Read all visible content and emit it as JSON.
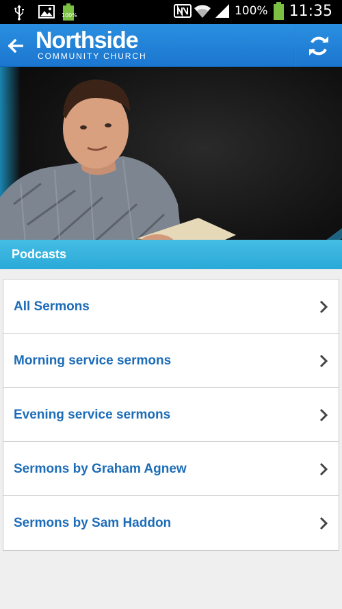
{
  "status_bar": {
    "battery_small_label": "100%",
    "battery_percent": "100%",
    "time": "11:35",
    "icons": [
      "usb-icon",
      "image-icon",
      "battery-icon",
      "nfc-icon",
      "wifi-icon",
      "signal-icon",
      "battery-icon"
    ]
  },
  "app_bar": {
    "logo_name": "Northside",
    "logo_sub": "COMMUNITY CHURCH",
    "back_icon": "arrow-left-icon",
    "refresh_icon": "refresh-icon"
  },
  "hero": {
    "caption": "Podcasts"
  },
  "list": {
    "items": [
      {
        "label": "All Sermons"
      },
      {
        "label": "Morning service sermons"
      },
      {
        "label": "Evening service sermons"
      },
      {
        "label": "Sermons by Graham Agnew"
      },
      {
        "label": "Sermons by Sam Haddon"
      }
    ]
  },
  "colors": {
    "app_bar": "#1f80d8",
    "caption_bar": "#3db5e0",
    "link_text": "#1c6cb8",
    "background": "#efefef"
  }
}
